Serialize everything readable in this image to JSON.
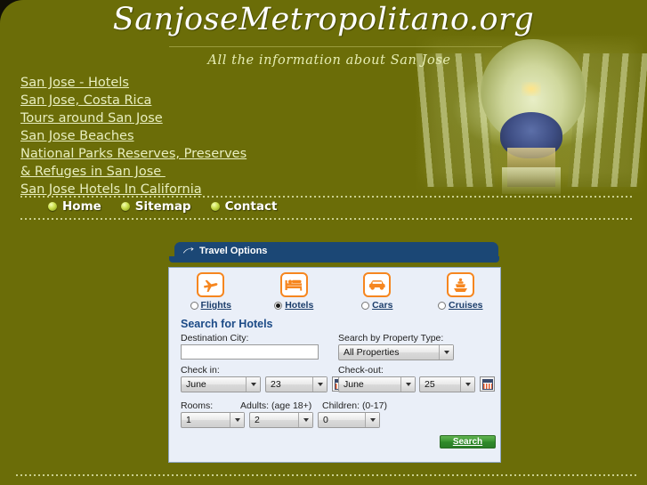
{
  "site": {
    "title": "SanjoseMetropolitano.org",
    "tagline": "All the information about San Jose",
    "background_color": "#6b6d08",
    "accent_color": "#1b4775"
  },
  "nav_links": [
    {
      "label": "San Jose - Hotels"
    },
    {
      "label": "San Jose, Costa Rica"
    },
    {
      "label": "Tours around San Jose"
    },
    {
      "label": "San Jose Beaches"
    },
    {
      "label": "National Parks Reserves, Preserves"
    },
    {
      "label": "& Refuges in San Jose "
    },
    {
      "label": "San Jose Hotels In California"
    }
  ],
  "bullet_nav": [
    {
      "label": "Home"
    },
    {
      "label": "Sitemap"
    },
    {
      "label": "Contact"
    }
  ],
  "widget": {
    "tab_label": "Travel Options",
    "tab_icon": "arrow-icon",
    "categories": [
      {
        "label": "Flights",
        "icon": "airplane-icon",
        "selected": false
      },
      {
        "label": "Hotels",
        "icon": "bed-icon",
        "selected": true
      },
      {
        "label": "Cars",
        "icon": "car-icon",
        "selected": false
      },
      {
        "label": "Cruises",
        "icon": "ship-icon",
        "selected": false
      }
    ],
    "form_title": "Search for Hotels",
    "fields": {
      "destination_label": "Destination City:",
      "destination_value": "",
      "destination_placeholder": "",
      "property_type_label": "Search by Property Type:",
      "property_type_value": "All Properties",
      "checkin_label": "Check in:",
      "checkin_month": "June",
      "checkin_day": "23",
      "checkout_label": "Check-out:",
      "checkout_month": "June",
      "checkout_day": "25",
      "rooms_label": "Rooms:",
      "rooms_value": "1",
      "adults_label": "Adults: (age 18+)",
      "adults_value": "2",
      "children_label": "Children: (0-17)",
      "children_value": "0"
    },
    "search_button": "Search"
  }
}
